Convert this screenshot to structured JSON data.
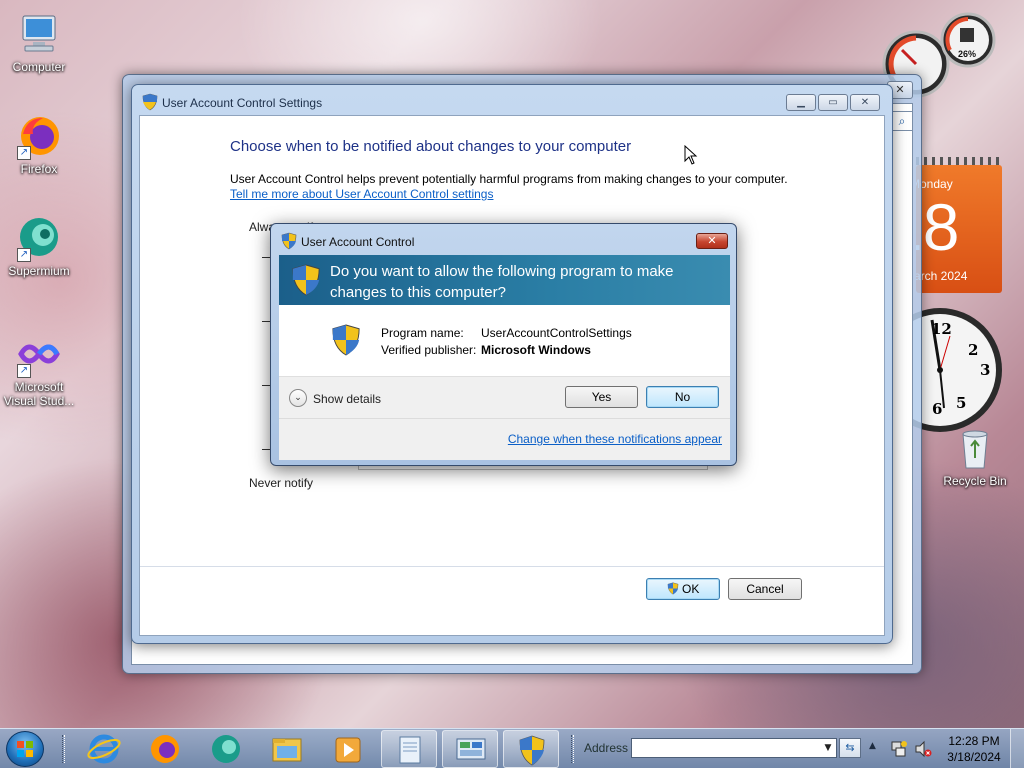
{
  "desktop": {
    "icons": [
      {
        "label": "Computer",
        "icon": "computer-icon"
      },
      {
        "label": "Firefox",
        "icon": "firefox-icon"
      },
      {
        "label": "Supermium",
        "icon": "supermium-icon"
      },
      {
        "label": "Microsoft Visual Stud...",
        "icon": "visual-studio-icon"
      },
      {
        "label": "Recycle Bin",
        "icon": "recycle-bin-icon"
      }
    ]
  },
  "gadgets": {
    "cpu_meter": {
      "value": "26%"
    },
    "calendar": {
      "weekday": "Monday",
      "day": "18",
      "month_year": "March 2024"
    },
    "clock": {
      "numerals": [
        "12",
        "2",
        "3",
        "5",
        "6"
      ]
    }
  },
  "uac_settings": {
    "title": "User Account Control Settings",
    "heading": "Choose when to be notified about changes to your computer",
    "description": "User Account Control helps prevent potentially harmful programs from making changes to your computer.",
    "link": "Tell me more about User Account Control settings",
    "slider_top": "Always notify",
    "slider_bottom": "Never notify",
    "ok_label": "OK",
    "cancel_label": "Cancel"
  },
  "uac_prompt": {
    "title": "User Account Control",
    "question": "Do you want to allow the following program to make changes to this computer?",
    "program_name_label": "Program name:",
    "program_name": "UserAccountControlSettings",
    "publisher_label": "Verified publisher:",
    "publisher": "Microsoft Windows",
    "show_details": "Show details",
    "yes_label": "Yes",
    "no_label": "No",
    "change_link": "Change when these notifications appear"
  },
  "taskbar": {
    "address_label": "Address",
    "address_value": "",
    "time": "12:28 PM",
    "date": "3/18/2024",
    "items": [
      "internet-explorer-icon",
      "firefox-icon",
      "supermium-icon",
      "file-explorer-icon",
      "media-player-icon",
      "document-icon",
      "control-panel-icon",
      "uac-shield-icon"
    ]
  },
  "colors": {
    "heading_blue": "#1e3287",
    "link_blue": "#0b5fc7",
    "uac_banner": "#1b5f8a",
    "calendar_orange": "#e8611a"
  }
}
